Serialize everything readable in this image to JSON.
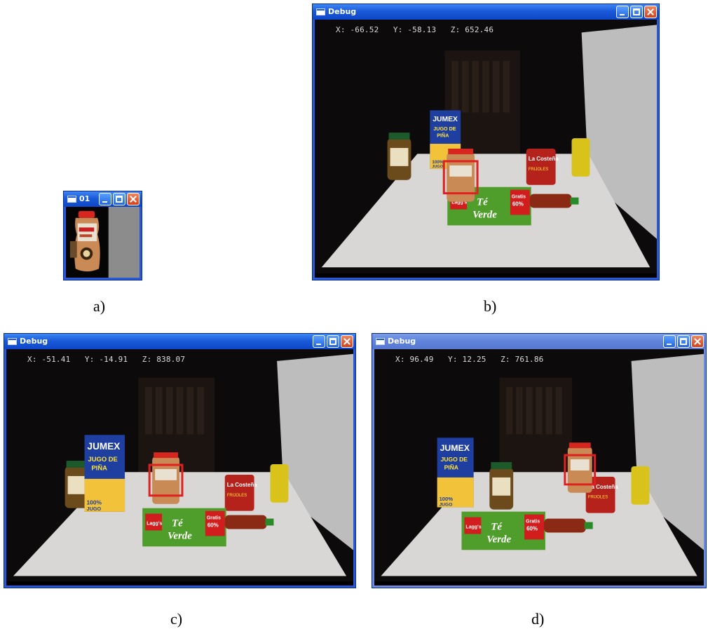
{
  "panels": {
    "a": {
      "caption": "a)",
      "window_title": "01"
    },
    "b": {
      "caption": "b)",
      "window_title": "Debug",
      "coords": "X: -66.52   Y: -58.13   Z: 652.46"
    },
    "c": {
      "caption": "c)",
      "window_title": "Debug",
      "coords": "X: -51.41   Y: -14.91   Z: 838.07"
    },
    "d": {
      "caption": "d)",
      "window_title": "Debug",
      "coords": "X: 96.49   Y: 12.25   Z: 761.86"
    }
  },
  "scene_labels": {
    "jumex": "JUMEX",
    "jugo": "JUGO DE",
    "pina": "PIÑA",
    "jugo_pct": "100%",
    "jugo_word": "JUGO",
    "lagg": "Lagg's",
    "te": "Té",
    "verde": "Verde",
    "gratis": "Gratis",
    "gratis_pct": "60%",
    "costena": "La Costeña",
    "frijoles": "FRIJOLES"
  },
  "colors": {
    "detection_box": "#e02020",
    "xp_title_active": "#1a5ad8",
    "table": "#d9d7d6",
    "background": "#0c0a0a"
  }
}
